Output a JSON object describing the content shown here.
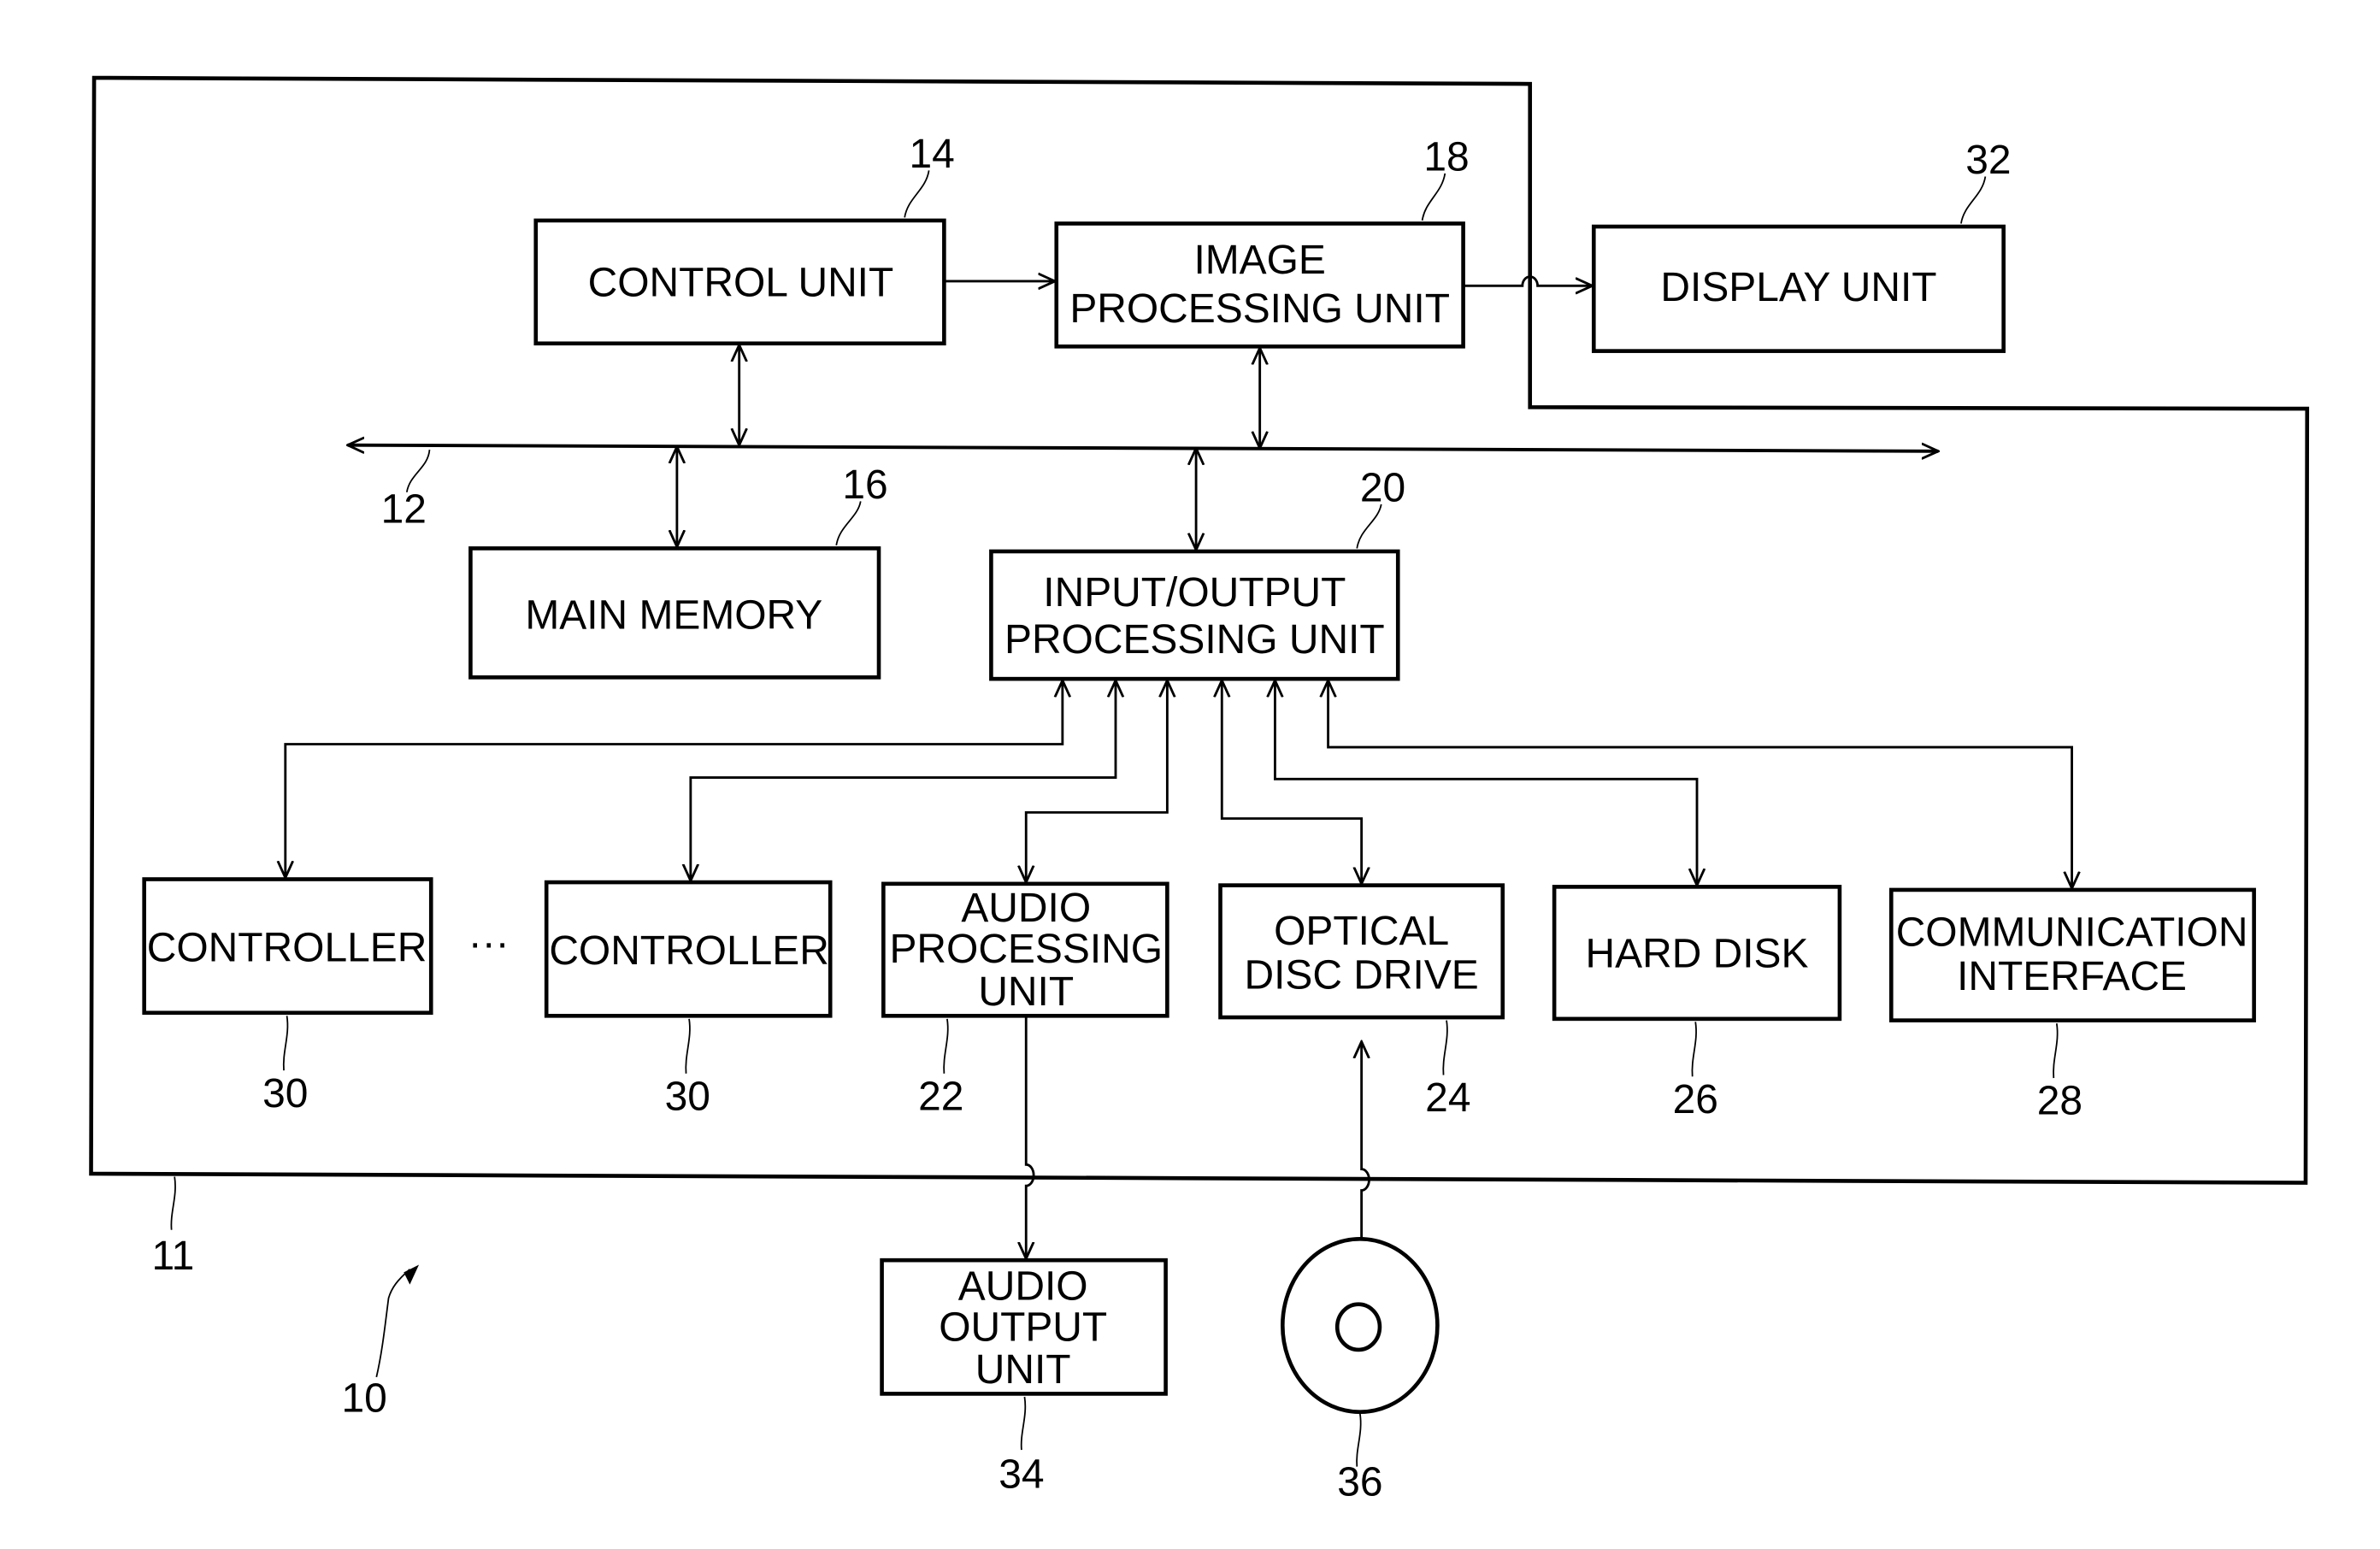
{
  "figure": {
    "device_ref": "10",
    "housing_ref": "11",
    "bus_ref": "12"
  },
  "blocks": {
    "control_unit": {
      "lines": [
        "CONTROL UNIT"
      ],
      "ref": "14"
    },
    "main_memory": {
      "lines": [
        "MAIN MEMORY"
      ],
      "ref": "16"
    },
    "image_processing_unit": {
      "lines": [
        "IMAGE",
        "PROCESSING UNIT"
      ],
      "ref": "18"
    },
    "io_processing_unit": {
      "lines": [
        "INPUT/OUTPUT",
        "PROCESSING UNIT"
      ],
      "ref": "20"
    },
    "audio_processing_unit": {
      "lines": [
        "AUDIO",
        "PROCESSING",
        "UNIT"
      ],
      "ref": "22"
    },
    "optical_disc_drive": {
      "lines": [
        "OPTICAL",
        "DISC DRIVE"
      ],
      "ref": "24"
    },
    "hard_disk": {
      "lines": [
        "HARD DISK"
      ],
      "ref": "26"
    },
    "communication_interface": {
      "lines": [
        "COMMUNICATION",
        "INTERFACE"
      ],
      "ref": "28"
    },
    "controller_1": {
      "lines": [
        "CONTROLLER"
      ],
      "ref": "30"
    },
    "controller_2": {
      "lines": [
        "CONTROLLER"
      ],
      "ref": "30"
    },
    "display_unit": {
      "lines": [
        "DISPLAY UNIT"
      ],
      "ref": "32"
    },
    "audio_output_unit": {
      "lines": [
        "AUDIO",
        "OUTPUT",
        "UNIT"
      ],
      "ref": "34"
    }
  },
  "disc": {
    "ref": "36"
  },
  "ellipsis": "···",
  "connections": [
    {
      "from": "control_unit",
      "to": "image_processing_unit",
      "kind": "one-way"
    },
    {
      "from": "image_processing_unit",
      "to": "display_unit",
      "kind": "one-way"
    },
    {
      "from": "control_unit",
      "to": "bus",
      "kind": "two-way"
    },
    {
      "from": "image_processing_unit",
      "to": "bus",
      "kind": "two-way"
    },
    {
      "from": "main_memory",
      "to": "bus",
      "kind": "two-way"
    },
    {
      "from": "io_processing_unit",
      "to": "bus",
      "kind": "two-way"
    },
    {
      "from": "io_processing_unit",
      "to": "controller_1",
      "kind": "two-way"
    },
    {
      "from": "io_processing_unit",
      "to": "controller_2",
      "kind": "two-way"
    },
    {
      "from": "io_processing_unit",
      "to": "audio_processing_unit",
      "kind": "two-way"
    },
    {
      "from": "io_processing_unit",
      "to": "optical_disc_drive",
      "kind": "two-way"
    },
    {
      "from": "io_processing_unit",
      "to": "hard_disk",
      "kind": "two-way"
    },
    {
      "from": "io_processing_unit",
      "to": "communication_interface",
      "kind": "two-way"
    },
    {
      "from": "audio_processing_unit",
      "to": "audio_output_unit",
      "kind": "one-way"
    },
    {
      "from": "disc",
      "to": "optical_disc_drive",
      "kind": "one-way"
    }
  ]
}
